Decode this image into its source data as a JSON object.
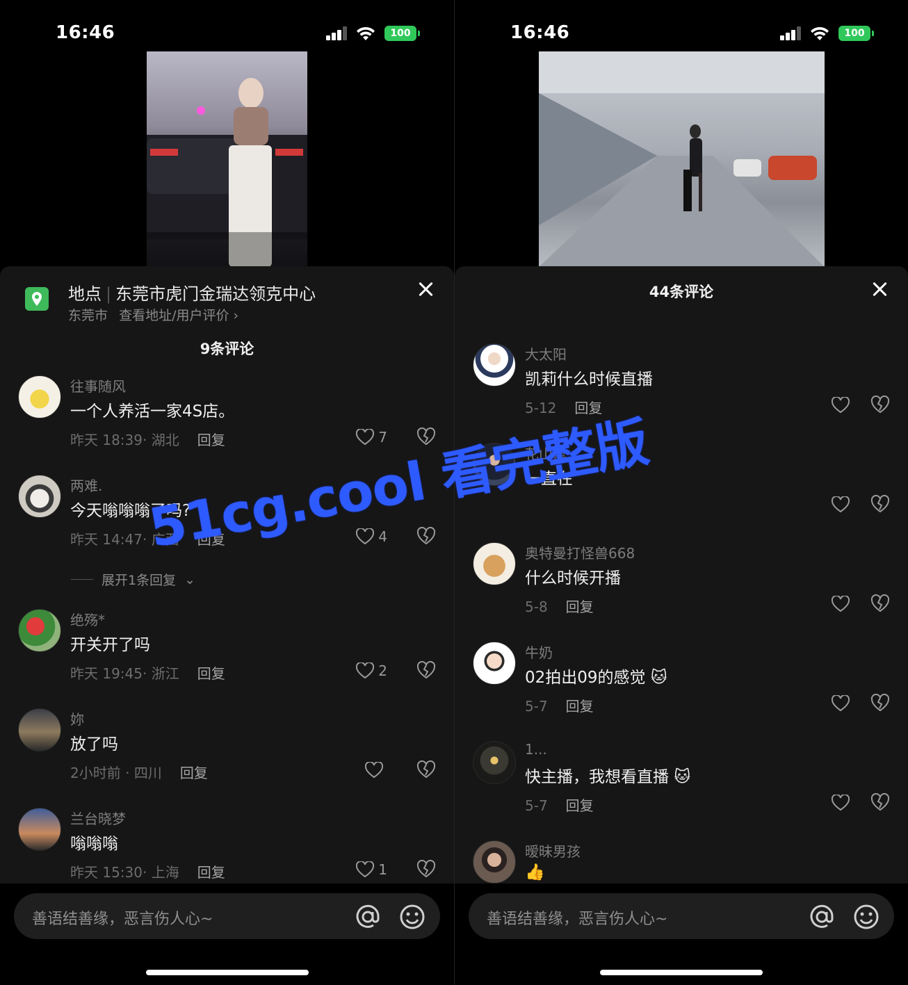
{
  "status": {
    "time": "16:46",
    "battery": "100"
  },
  "left": {
    "location_label": "地点",
    "location_name": "东莞市虎门金瑞达领克中心",
    "location_city": "东莞市",
    "location_link": "查看地址/用户评价",
    "comment_count": "9条评论",
    "expand_text": "展开1条回复",
    "comments": [
      {
        "name": "往事随风",
        "text": "一个人养活一家4S店。",
        "time": "昨天 18:39",
        "region": "湖北",
        "likes": "7"
      },
      {
        "name": "两难.",
        "text": "今天嗡嗡嗡了吗?",
        "time": "昨天 14:47",
        "region": "广西",
        "likes": "4"
      },
      {
        "name": "绝殇*",
        "text": "开关开了吗",
        "time": "昨天 19:45",
        "region": "浙江",
        "likes": "2"
      },
      {
        "name": "妳",
        "text": "放了吗",
        "time": "2小时前",
        "region": "四川",
        "likes": ""
      },
      {
        "name": "兰台晓梦",
        "text": "嗡嗡嗡",
        "time": "昨天 15:30",
        "region": "上海",
        "likes": "1"
      }
    ]
  },
  "right": {
    "comment_count": "44条评论",
    "comments": [
      {
        "name": "大太阳",
        "text": "凯莉什么时候直播",
        "time": "5-12",
        "likes": ""
      },
      {
        "name": "花山熏",
        "text": "一直在",
        "time": "",
        "likes": ""
      },
      {
        "name": "奥特曼打怪兽668",
        "text": "什么时候开播",
        "time": "5-8",
        "likes": ""
      },
      {
        "name": "牛奶",
        "text": "02拍出09的感觉",
        "time": "5-7",
        "likes": ""
      },
      {
        "name": "1...",
        "text": "快主播，我想看直播",
        "time": "5-7",
        "likes": ""
      },
      {
        "name": "暧昧男孩",
        "text": "👍",
        "time": "",
        "likes": ""
      }
    ]
  },
  "common": {
    "reply_label": "回复",
    "input_placeholder": "善语结善缘，恶言伤人心~",
    "watermark": "51cg.cool 看完整版"
  },
  "colors": {
    "accent_green": "#3fba5a",
    "battery_green": "#30c85a",
    "watermark_blue": "#2e5bff"
  }
}
